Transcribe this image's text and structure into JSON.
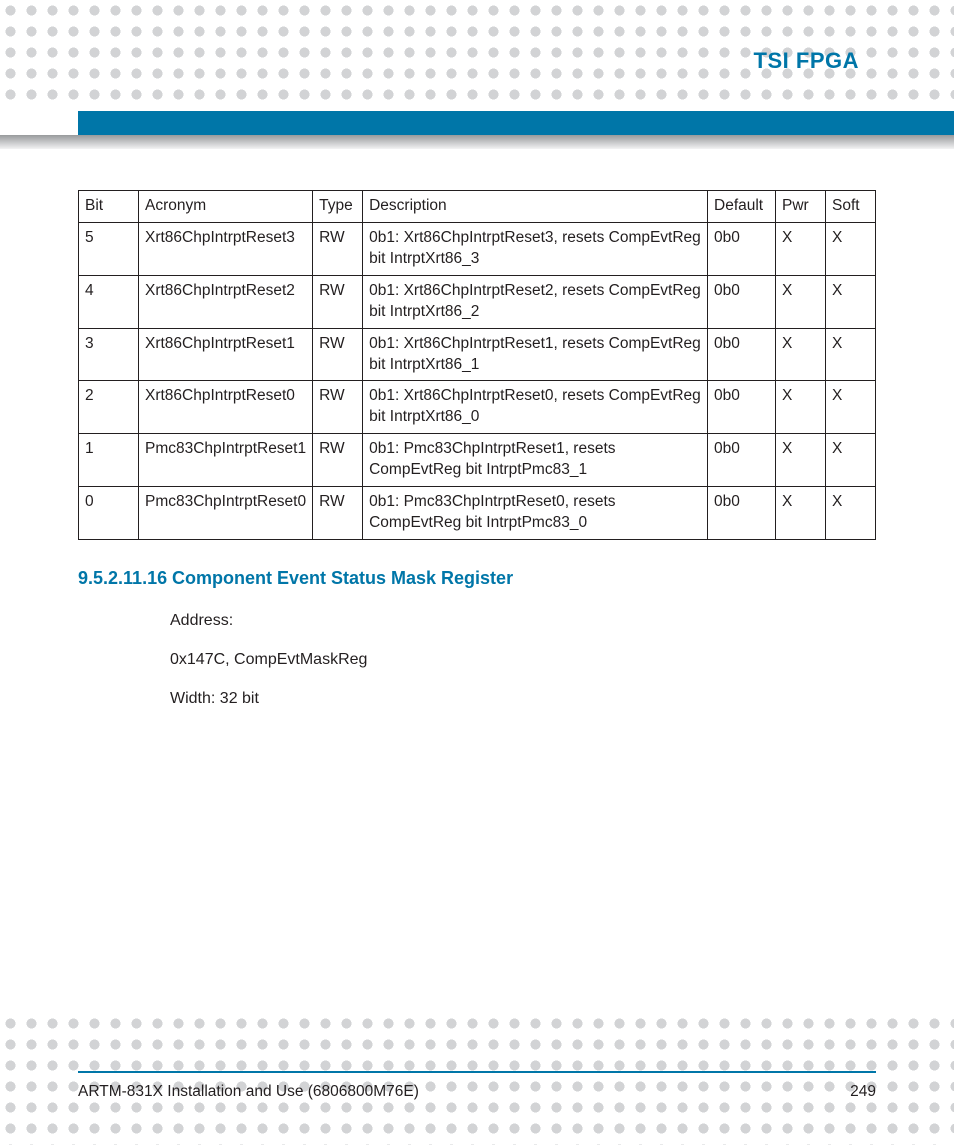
{
  "header": {
    "title": "TSI FPGA"
  },
  "table": {
    "columns": [
      "Bit",
      "Acronym",
      "Type",
      "Description",
      "Default",
      "Pwr",
      "Soft"
    ],
    "rows": [
      {
        "bit": "5",
        "acronym": "Xrt86ChpIntrptReset3",
        "type": "RW",
        "description": "0b1: Xrt86ChpIntrptReset3, resets CompEvtReg bit IntrptXrt86_3",
        "default": "0b0",
        "pwr": "X",
        "soft": "X"
      },
      {
        "bit": "4",
        "acronym": "Xrt86ChpIntrptReset2",
        "type": "RW",
        "description": "0b1: Xrt86ChpIntrptReset2, resets CompEvtReg bit IntrptXrt86_2",
        "default": "0b0",
        "pwr": "X",
        "soft": "X"
      },
      {
        "bit": "3",
        "acronym": "Xrt86ChpIntrptReset1",
        "type": "RW",
        "description": "0b1: Xrt86ChpIntrptReset1, resets CompEvtReg bit IntrptXrt86_1",
        "default": "0b0",
        "pwr": "X",
        "soft": "X"
      },
      {
        "bit": "2",
        "acronym": "Xrt86ChpIntrptReset0",
        "type": "RW",
        "description": "0b1: Xrt86ChpIntrptReset0, resets CompEvtReg bit IntrptXrt86_0",
        "default": "0b0",
        "pwr": "X",
        "soft": "X"
      },
      {
        "bit": "1",
        "acronym": "Pmc83ChpIntrptReset1",
        "type": "RW",
        "description": "0b1: Pmc83ChpIntrptReset1, resets CompEvtReg bit IntrptPmc83_1",
        "default": "0b0",
        "pwr": "X",
        "soft": "X"
      },
      {
        "bit": "0",
        "acronym": "Pmc83ChpIntrptReset0",
        "type": "RW",
        "description": "0b1: Pmc83ChpIntrptReset0, resets CompEvtReg bit IntrptPmc83_0",
        "default": "0b0",
        "pwr": "X",
        "soft": "X"
      }
    ]
  },
  "section": {
    "number": "9.5.2.11.16",
    "title": "Component Event Status Mask Register",
    "address_label": "Address:",
    "address_value": "0x147C, CompEvtMaskReg",
    "width_line": "Width: 32 bit"
  },
  "footer": {
    "doc": "ARTM-831X Installation and Use (6806800M76E)",
    "page": "249"
  }
}
